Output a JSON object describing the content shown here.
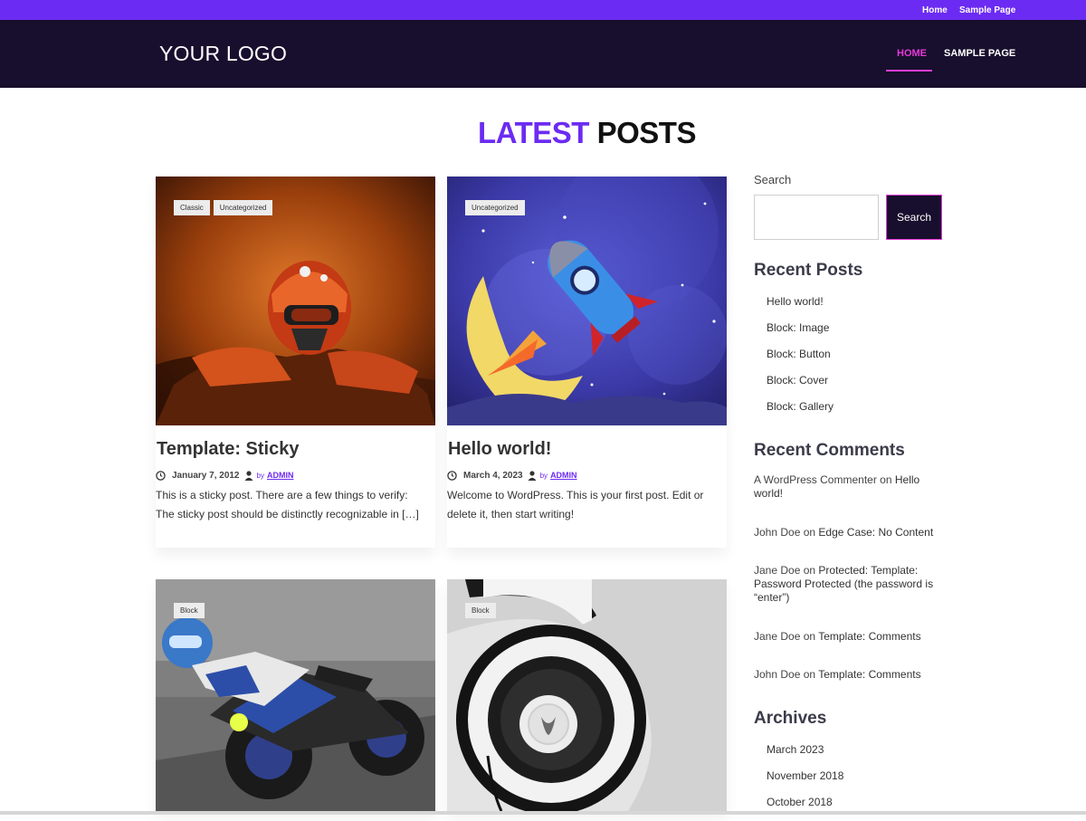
{
  "topbar": {
    "links": [
      "Home",
      "Sample Page"
    ]
  },
  "header": {
    "logo": "YOUR LOGO",
    "nav": [
      {
        "label": "HOME"
      },
      {
        "label": "SAMPLE PAGE"
      }
    ]
  },
  "section": {
    "title_accent": "LATEST",
    "title_rest": "POSTS"
  },
  "posts": [
    {
      "title": "Template: Sticky",
      "date": "January 7, 2012",
      "by": "by",
      "author": "ADMIN",
      "excerpt": "This is a sticky post. There are a few things to verify: The sticky post should be distinctly recognizable in […]",
      "tags": [
        "Classic",
        "Uncategorized"
      ]
    },
    {
      "title": "Hello world!",
      "date": "March 4, 2023",
      "by": "by",
      "author": "ADMIN",
      "excerpt": "Welcome to WordPress. This is your first post. Edit or delete it, then start writing!",
      "tags": [
        "Uncategorized"
      ]
    },
    {
      "tags": [
        "Block"
      ]
    },
    {
      "tags": [
        "Block"
      ]
    }
  ],
  "sidebar": {
    "search_label": "Search",
    "search_button": "Search",
    "recent_posts_title": "Recent Posts",
    "recent_posts": [
      "Hello world!",
      "Block: Image",
      "Block: Button",
      "Block: Cover",
      "Block: Gallery"
    ],
    "recent_comments_title": "Recent Comments",
    "comments": [
      {
        "author": "A WordPress Commenter",
        "on": "on",
        "post": "Hello world!"
      },
      {
        "author": "John Doe",
        "on": "on",
        "post": "Edge Case: No Content"
      },
      {
        "author": "Jane Doe",
        "on": "on",
        "post": "Protected: Template: Password Protected (the password is “enter”)"
      },
      {
        "author": "Jane Doe",
        "on": "on",
        "post": "Template: Comments"
      },
      {
        "author": "John Doe",
        "on": "on",
        "post": "Template: Comments"
      }
    ],
    "archives_title": "Archives",
    "archives": [
      "March 2023",
      "November 2018",
      "October 2018"
    ]
  },
  "colors": {
    "accent": "#6c2bf2",
    "header_bg": "#170f2d",
    "nav_active": "#e63ad5"
  },
  "icons": {
    "date": "clock-icon",
    "author": "user-icon"
  }
}
